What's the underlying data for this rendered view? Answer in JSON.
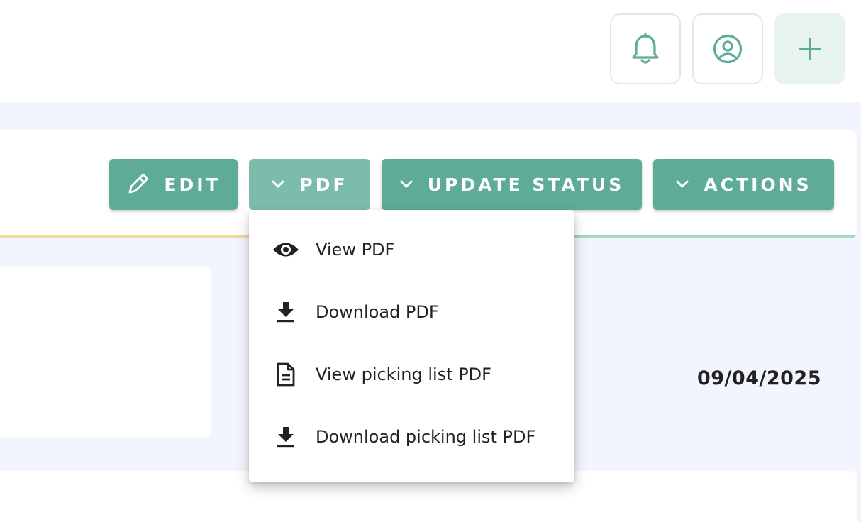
{
  "topbar": {
    "notifications_icon": "bell-icon",
    "profile_icon": "user-circle-icon",
    "add_icon": "plus-icon",
    "accent_color": "#5eab98"
  },
  "toolbar": {
    "edit_label": "EDIT",
    "pdf_label": "PDF",
    "update_status_label": "UPDATE STATUS",
    "actions_label": "ACTIONS"
  },
  "progress": {
    "fraction": 0.67
  },
  "info": {
    "date": "09/04/2025"
  },
  "pdf_menu": {
    "items": [
      {
        "label": "View PDF",
        "icon": "eye-icon"
      },
      {
        "label": "Download PDF",
        "icon": "download-icon"
      },
      {
        "label": "View picking list PDF",
        "icon": "document-icon"
      },
      {
        "label": "Download picking list PDF",
        "icon": "download-icon"
      }
    ]
  }
}
